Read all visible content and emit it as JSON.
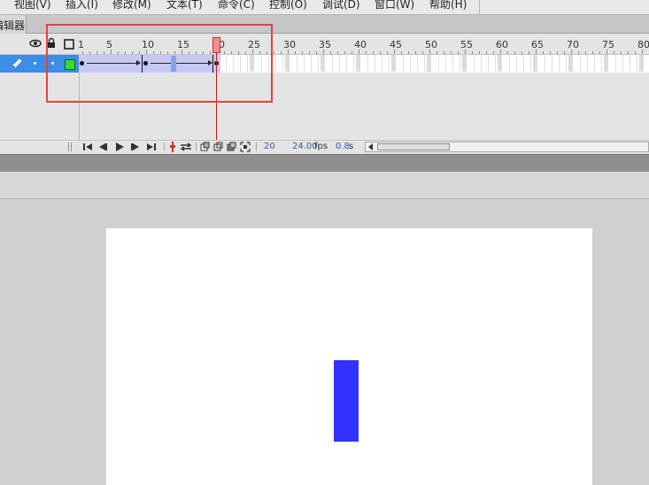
{
  "menu": {
    "items": [
      {
        "label": "视图(V)"
      },
      {
        "label": "插入(I)"
      },
      {
        "label": "修改(M)"
      },
      {
        "label": "文本(T)"
      },
      {
        "label": "命令(C)"
      },
      {
        "label": "控制(O)"
      },
      {
        "label": "调试(D)"
      },
      {
        "label": "窗口(W)"
      },
      {
        "label": "帮助(H)"
      }
    ]
  },
  "panel": {
    "tab_label": "编辑器"
  },
  "timeline": {
    "ruler_labels": [
      "1",
      "5",
      "10",
      "15",
      "20",
      "25",
      "30",
      "35",
      "40",
      "45",
      "50",
      "55",
      "60",
      "65",
      "70",
      "75",
      "80"
    ],
    "layer": {
      "icon": "pencil-icon"
    },
    "playhead_frame": 20
  },
  "status": {
    "current_frame": "20",
    "fps_value": "24.00",
    "fps_unit": "fps",
    "time_value": "0.8",
    "time_unit": "s"
  },
  "colors": {
    "selected_layer": "#3b8de6",
    "tween_fill": "#c8c8f6",
    "playhead": "#cc1b1b",
    "highlight": "#e8403c",
    "shape": "#3333ff",
    "layer_color_box": "#33dd33"
  }
}
